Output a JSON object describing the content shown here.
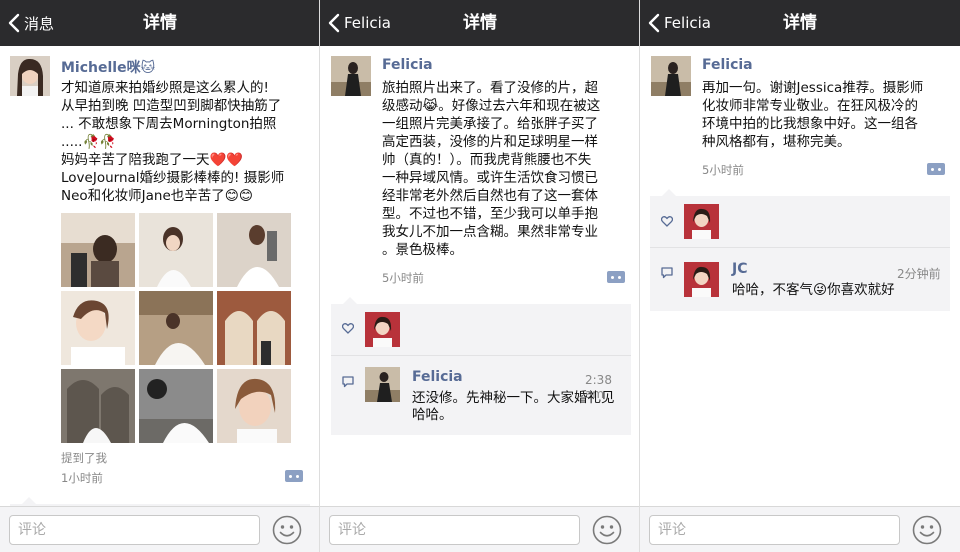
{
  "panels": [
    {
      "nav": {
        "back_label": "消息",
        "title": "详情"
      },
      "post": {
        "author": "Michelle咪🐱",
        "lines": [
          "才知道原来拍婚纱照是这么累人的!",
          "从早拍到晚 凹造型凹到脚都快抽筋了",
          "... 不敢想象下周去Mornington拍照",
          ".....🥀🥀",
          "妈妈辛苦了陪我跑了一天❤️❤️",
          "LoveJournal婚纱摄影棒棒的! 摄影师",
          "Neo和化妆师Jane也辛苦了😊😊"
        ],
        "mention": "提到了我",
        "time": "1小时前"
      },
      "input": {
        "placeholder": "评论"
      }
    },
    {
      "nav": {
        "back_label": "Felicia",
        "title": "详情"
      },
      "post": {
        "author": "Felicia",
        "lines": [
          "旅拍照片出来了。看了没修的片，超",
          "级感动😹。好像过去六年和现在被这",
          "一组照片完美承接了。给张胖子买了",
          "高定西装，没修的片和足球明星一样",
          "帅（真的！）。而我虎背熊腰也不失",
          "一种异域风情。或许生活饮食习惯已",
          "经非常老外然后自然也有了这一套体",
          "型。不过也不错，至少我可以单手抱",
          "我女儿不加一点含糊。果然非常专业",
          "。景色极棒。"
        ],
        "time": "5小时前"
      },
      "comment": {
        "author": "Felicia",
        "time": "2:38 am",
        "lines": [
          "还没修。先神秘一下。大家婚礼见",
          "哈哈。"
        ]
      },
      "input": {
        "placeholder": "评论"
      }
    },
    {
      "nav": {
        "back_label": "Felicia",
        "title": "详情"
      },
      "post": {
        "author": "Felicia",
        "lines": [
          "再加一句。谢谢Jessica推荐。摄影师",
          "化妆师非常专业敬业。在狂风极冷的",
          "环境中拍的比我想象中好。这一组各",
          "种风格都有，堪称完美。"
        ],
        "time": "5小时前"
      },
      "comment": {
        "author": "JC",
        "time": "2分钟前",
        "lines": [
          "哈哈，不客气😜你喜欢就好"
        ]
      },
      "input": {
        "placeholder": "评论"
      }
    }
  ],
  "colors": {
    "nav_bg": "#2b2b2d",
    "link_blue": "#576b95",
    "meta_gray": "#888888",
    "interaction_bg": "#f3f3f5"
  },
  "icons": {
    "back": "chevron-left-icon",
    "like": "heart-icon",
    "comment": "speech-bubble-icon",
    "more": "more-dots-icon",
    "emoji": "smiley-face-icon"
  }
}
